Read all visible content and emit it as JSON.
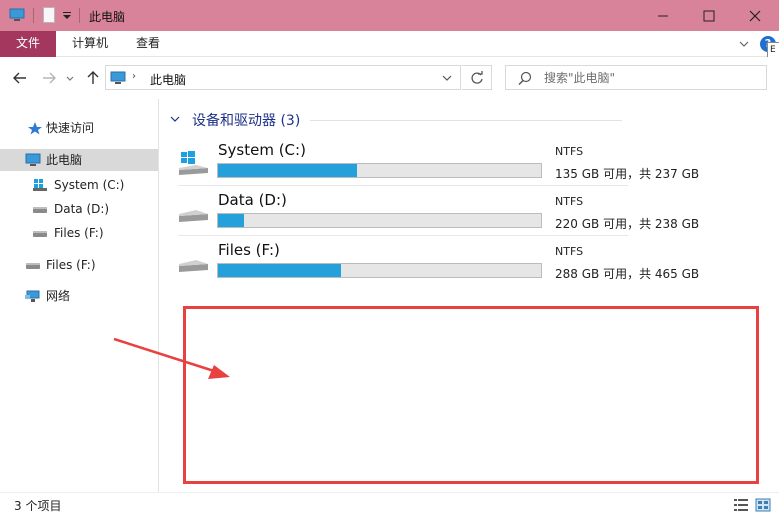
{
  "window": {
    "title": "此电脑"
  },
  "ribbon": {
    "tabs": [
      {
        "label": "文件"
      },
      {
        "label": "计算机"
      },
      {
        "label": "查看"
      }
    ],
    "help_label": "?",
    "tooltip_fragment": "E"
  },
  "address": {
    "path": [
      "此电脑"
    ],
    "search_placeholder": "搜索\"此电脑\""
  },
  "sidebar": {
    "items": [
      {
        "label": "快速访问",
        "icon": "star-icon"
      },
      {
        "label": "此电脑",
        "icon": "computer-icon",
        "selected": true
      },
      {
        "label": "System (C:)",
        "icon": "windows-drive-icon"
      },
      {
        "label": "Data (D:)",
        "icon": "drive-icon"
      },
      {
        "label": "Files (F:)",
        "icon": "drive-icon"
      },
      {
        "label": "Files (F:)",
        "icon": "drive-icon"
      },
      {
        "label": "网络",
        "icon": "network-icon"
      }
    ]
  },
  "content": {
    "group_title": "设备和驱动器 (3)",
    "drives": [
      {
        "name": "System (C:)",
        "fs": "NTFS",
        "space": "135 GB 可用，共 237 GB",
        "used_fraction": 0.43
      },
      {
        "name": "Data (D:)",
        "fs": "NTFS",
        "space": "220 GB 可用，共 238 GB",
        "used_fraction": 0.08
      },
      {
        "name": "Files (F:)",
        "fs": "NTFS",
        "space": "288 GB 可用，共 465 GB",
        "used_fraction": 0.38
      }
    ]
  },
  "status": {
    "item_count": "3 个项目"
  },
  "colors": {
    "titlebar": "#d9839a",
    "file_tab": "#a4375d",
    "usage_bar": "#26a0da",
    "annotation_red": "#e94040"
  }
}
